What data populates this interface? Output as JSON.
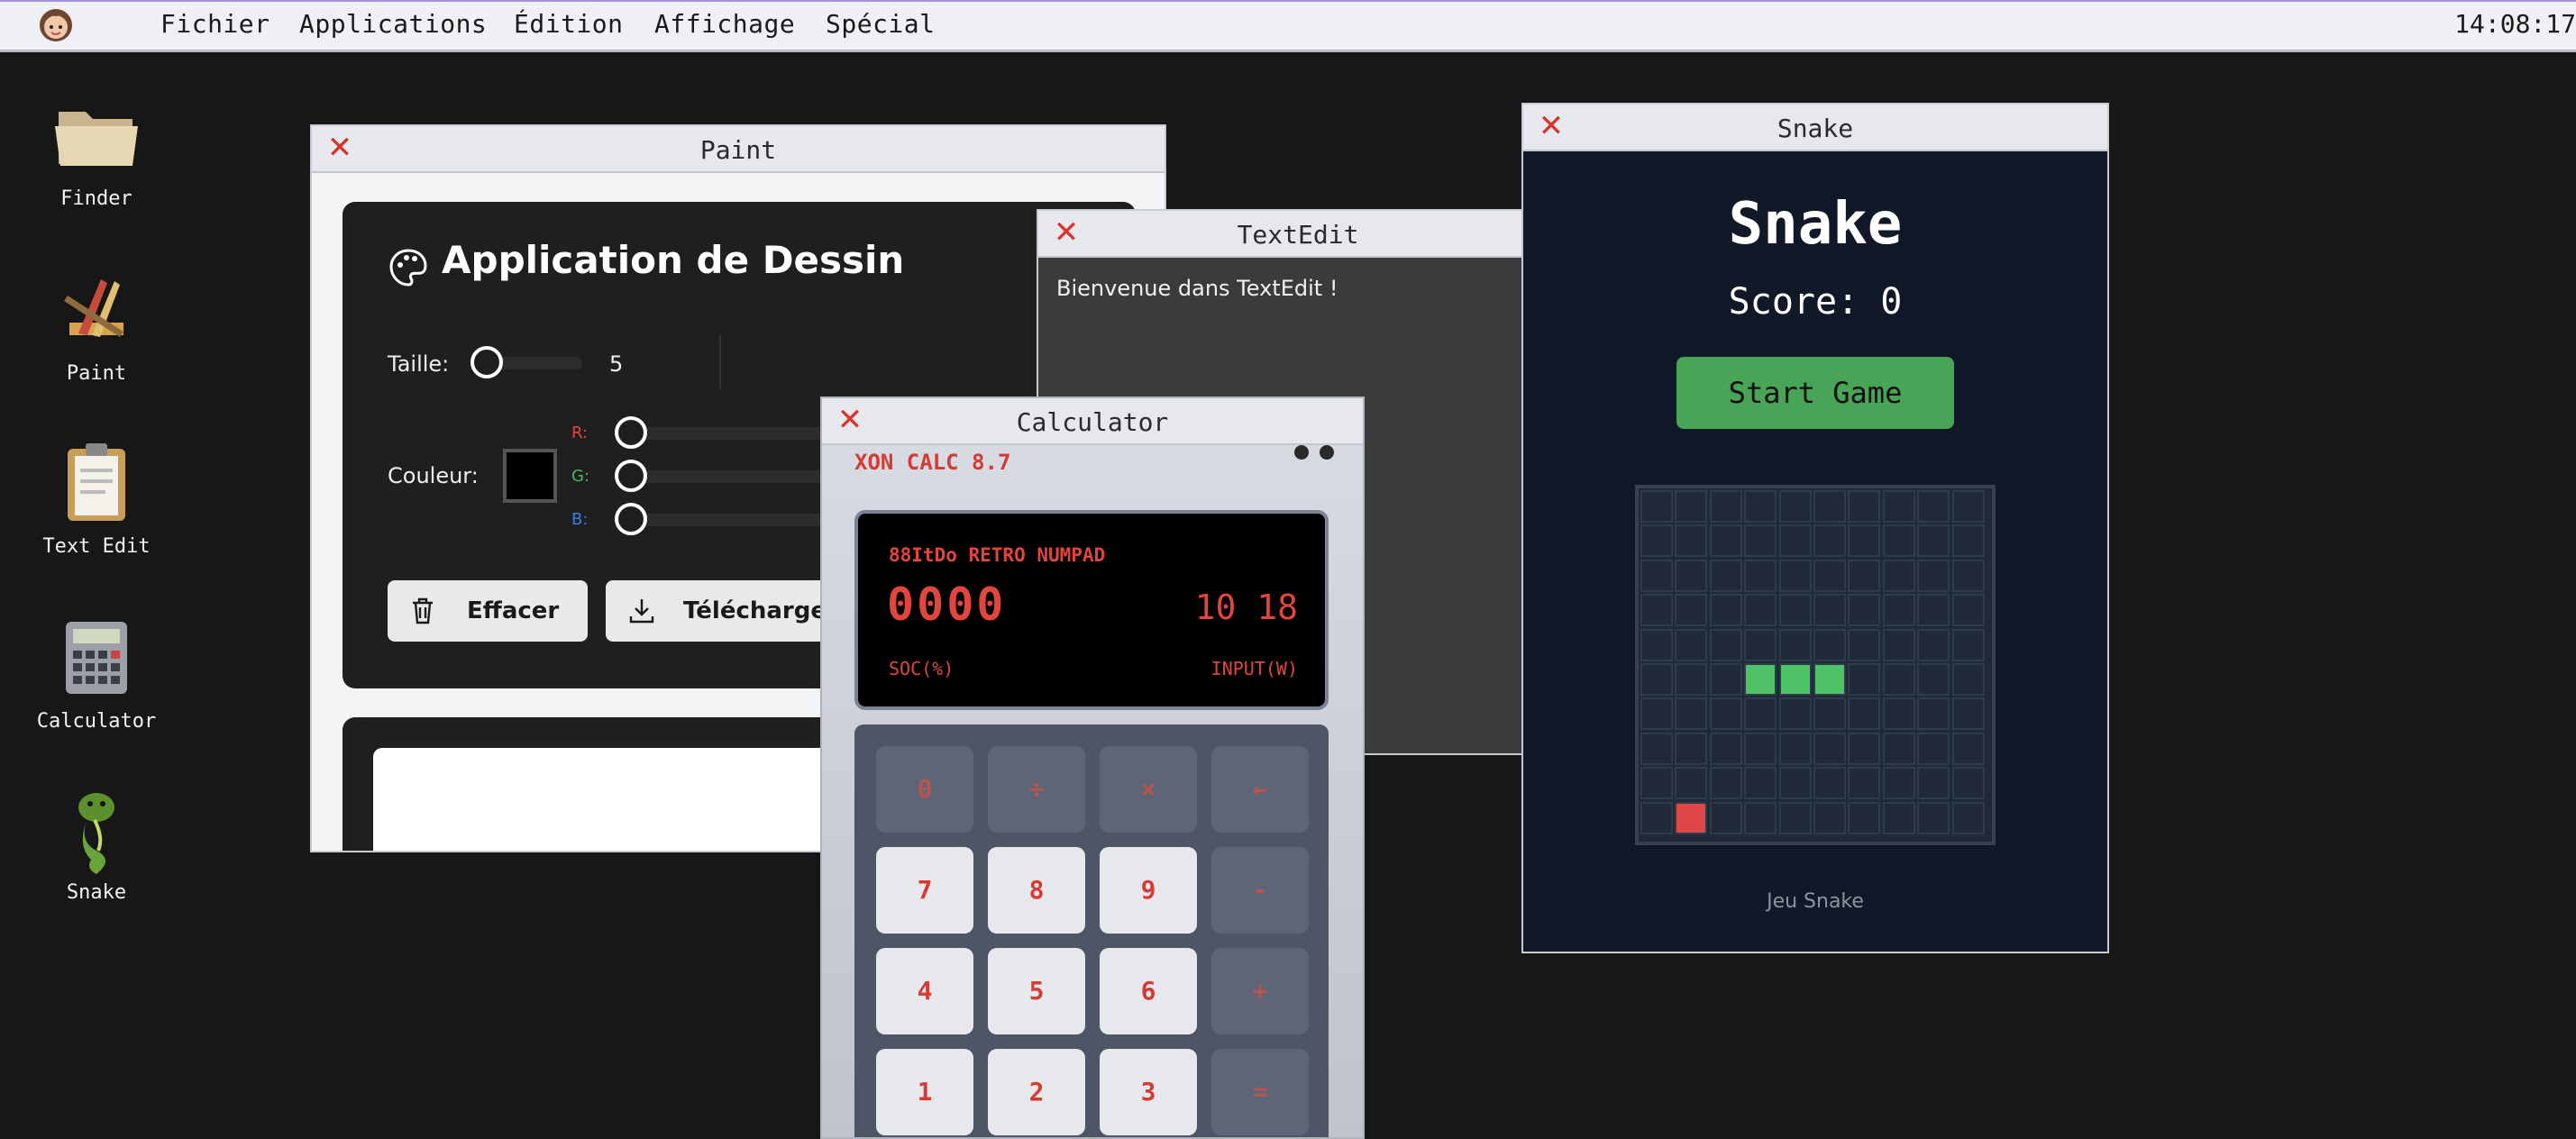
{
  "menubar": {
    "items": [
      "Fichier",
      "Applications",
      "Édition",
      "Affichage",
      "Spécial"
    ],
    "clock": "14:08:17"
  },
  "desktop": {
    "icons": [
      {
        "label": "Finder",
        "icon": "folder-icon"
      },
      {
        "label": "Paint",
        "icon": "paint-icon"
      },
      {
        "label": "Text Edit",
        "icon": "clipboard-icon"
      },
      {
        "label": "Calculator",
        "icon": "calculator-icon"
      },
      {
        "label": "Snake",
        "icon": "snake-icon"
      }
    ]
  },
  "paint": {
    "window_title": "Paint",
    "app_title": "Application de Dessin",
    "size_label": "Taille:",
    "size_value": "5",
    "color_label": "Couleur:",
    "r_label": "R:",
    "g_label": "G:",
    "b_label": "B:",
    "clear_button": "Effacer",
    "download_button": "Télécharger",
    "colors": {
      "r": "#e0463d",
      "g": "#46b85c",
      "b": "#3d7fe0"
    }
  },
  "textedit": {
    "window_title": "TextEdit",
    "content": "Bienvenue dans TextEdit !"
  },
  "calculator": {
    "window_title": "Calculator",
    "brand": "XON CALC 8.7",
    "screen_header": "88ItDo RETRO NUMPAD",
    "display": "0000",
    "display_right": "10  18",
    "footer_left": "SOC(%)",
    "footer_right": "INPUT(W)",
    "keys": [
      [
        "0",
        "÷",
        "×",
        "←"
      ],
      [
        "7",
        "8",
        "9",
        "-"
      ],
      [
        "4",
        "5",
        "6",
        "+"
      ],
      [
        "1",
        "2",
        "3",
        "="
      ]
    ]
  },
  "snake": {
    "window_title": "Snake",
    "title": "Snake",
    "score": "Score: 0",
    "start_button": "Start Game",
    "footer": "Jeu Snake",
    "grid_size": 10,
    "snake_cells": [
      [
        3,
        5
      ],
      [
        4,
        5
      ],
      [
        5,
        5
      ]
    ],
    "food_cell": [
      1,
      9
    ],
    "colors": {
      "snake": "#4fc166",
      "food": "#e04646",
      "button": "#48a456"
    }
  }
}
